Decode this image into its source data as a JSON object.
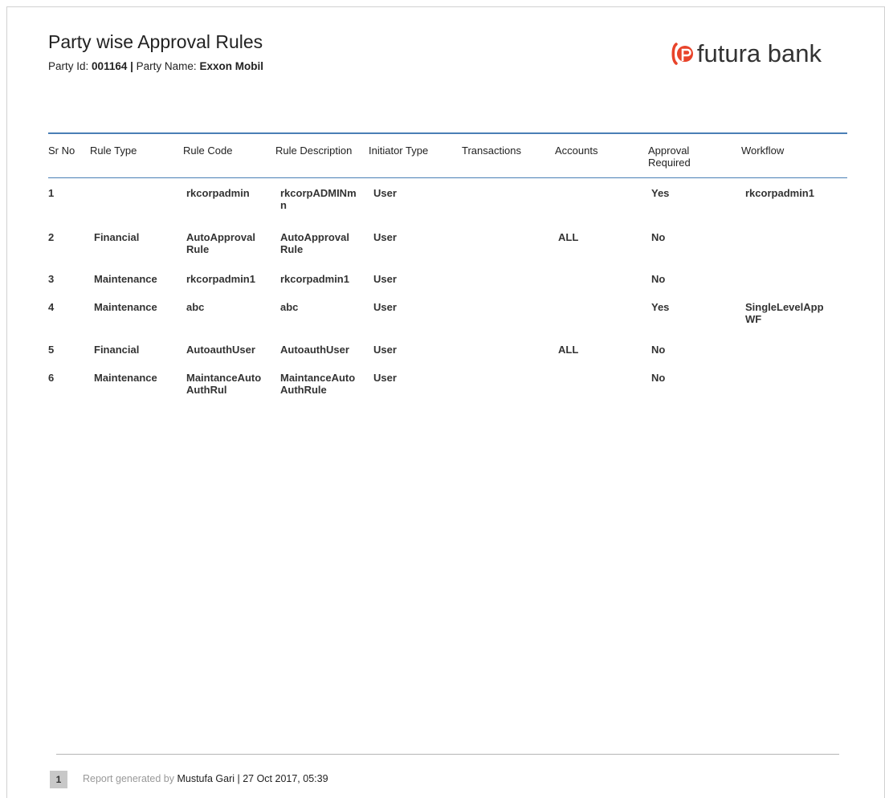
{
  "header": {
    "title": "Party wise Approval Rules",
    "party_id_label": "Party Id:",
    "party_id": "001164 |",
    "party_name_label": "Party Name:",
    "party_name": "Exxon Mobil",
    "brand_name": "futura bank",
    "brand_color": "#e8432a"
  },
  "table": {
    "columns": [
      "Sr No",
      "Rule Type",
      "Rule Code",
      "Rule Description",
      "Initiator Type",
      "Transactions",
      "Accounts",
      "Approval Required",
      "Workflow"
    ],
    "rows": [
      [
        "1",
        "",
        "rkcorpadmin",
        "rkcorpADMINmn",
        "User",
        "",
        "",
        "Yes",
        "rkcorpadmin1"
      ],
      [
        "2",
        "Financial",
        "AutoApprovalRule",
        "AutoApprovalRule",
        "User",
        "",
        "ALL",
        "No",
        ""
      ],
      [
        "3",
        "Maintenance",
        "rkcorpadmin1",
        "rkcorpadmin1",
        "User",
        "",
        "",
        "No",
        ""
      ],
      [
        "4",
        "Maintenance",
        "abc",
        "abc",
        "User",
        "",
        "",
        "Yes",
        "SingleLevelAppWF"
      ],
      [
        "5",
        "Financial",
        "AutoauthUser",
        "AutoauthUser",
        "User",
        "",
        "ALL",
        "No",
        ""
      ],
      [
        "6",
        "Maintenance",
        "MaintanceAutoAuthRul",
        "MaintanceAutoAuthRule",
        "User",
        "",
        "",
        "No",
        ""
      ]
    ]
  },
  "footer": {
    "page_number": "1",
    "generated_by_label": "Report generated by",
    "generated_by_value": "Mustufa Gari | 27 Oct 2017, 05:39"
  }
}
